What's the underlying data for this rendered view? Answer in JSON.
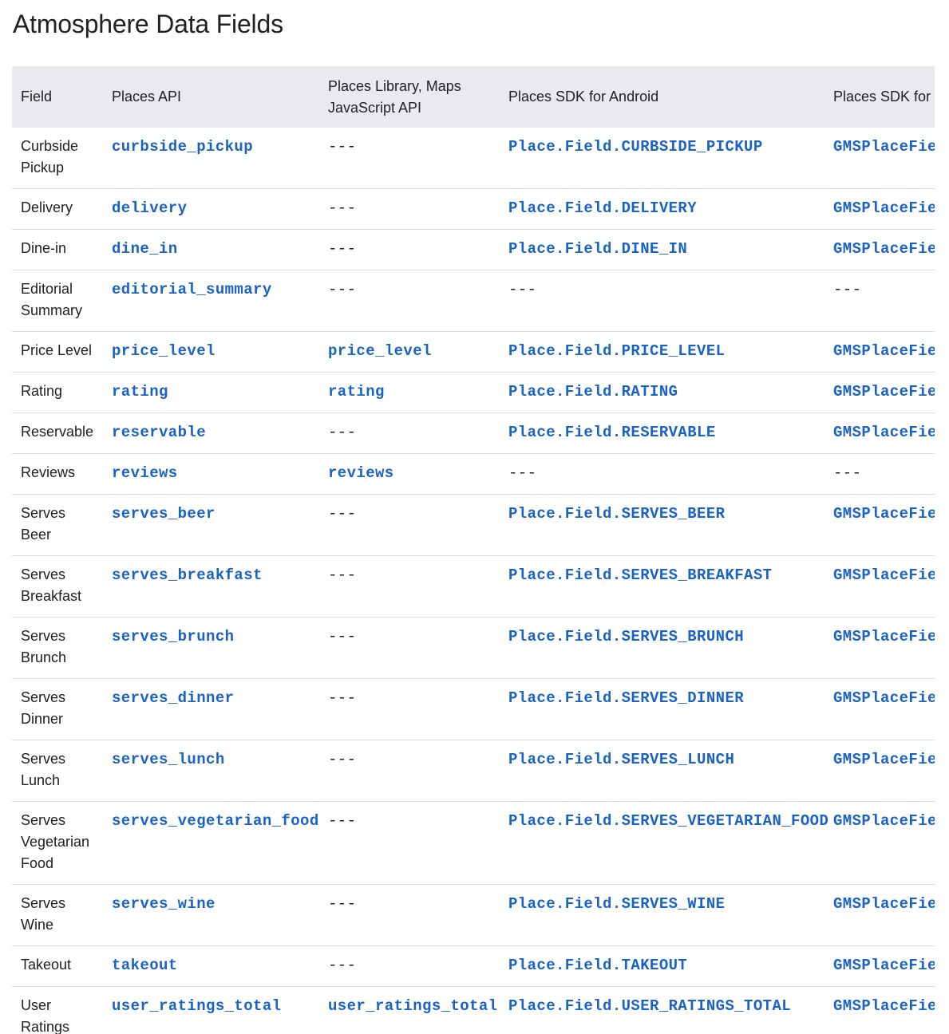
{
  "page": {
    "title": "Atmosphere Data Fields"
  },
  "table": {
    "headers": [
      "Field",
      "Places API",
      "Places Library, Maps JavaScript API",
      "Places SDK for Android",
      "Places SDK for"
    ],
    "rows": [
      {
        "field": "Curbside Pickup",
        "places_api": "curbside_pickup",
        "js_api": "---",
        "android": "Place.Field.CURBSIDE_PICKUP",
        "ios": "GMSPlaceFie"
      },
      {
        "field": "Delivery",
        "places_api": "delivery",
        "js_api": "---",
        "android": "Place.Field.DELIVERY",
        "ios": "GMSPlaceFie"
      },
      {
        "field": "Dine-in",
        "places_api": "dine_in",
        "js_api": "---",
        "android": "Place.Field.DINE_IN",
        "ios": "GMSPlaceFie"
      },
      {
        "field": "Editorial Summary",
        "places_api": "editorial_summary",
        "js_api": "---",
        "android": "---",
        "ios": "---"
      },
      {
        "field": "Price Level",
        "places_api": "price_level",
        "js_api": "price_level",
        "android": "Place.Field.PRICE_LEVEL",
        "ios": "GMSPlaceFie"
      },
      {
        "field": "Rating",
        "places_api": "rating",
        "js_api": "rating",
        "android": "Place.Field.RATING",
        "ios": "GMSPlaceFie"
      },
      {
        "field": "Reservable",
        "places_api": "reservable",
        "js_api": "---",
        "android": "Place.Field.RESERVABLE",
        "ios": "GMSPlaceFie"
      },
      {
        "field": "Reviews",
        "places_api": "reviews",
        "js_api": "reviews",
        "android": "---",
        "ios": "---"
      },
      {
        "field": "Serves Beer",
        "places_api": "serves_beer",
        "js_api": "---",
        "android": "Place.Field.SERVES_BEER",
        "ios": "GMSPlaceFie"
      },
      {
        "field": "Serves Breakfast",
        "places_api": "serves_breakfast",
        "js_api": "---",
        "android": "Place.Field.SERVES_BREAKFAST",
        "ios": "GMSPlaceFie"
      },
      {
        "field": "Serves Brunch",
        "places_api": "serves_brunch",
        "js_api": "---",
        "android": "Place.Field.SERVES_BRUNCH",
        "ios": "GMSPlaceFie"
      },
      {
        "field": "Serves Dinner",
        "places_api": "serves_dinner",
        "js_api": "---",
        "android": "Place.Field.SERVES_DINNER",
        "ios": "GMSPlaceFie"
      },
      {
        "field": "Serves Lunch",
        "places_api": "serves_lunch",
        "js_api": "---",
        "android": "Place.Field.SERVES_LUNCH",
        "ios": "GMSPlaceFie"
      },
      {
        "field": "Serves Vegetarian Food",
        "places_api": "serves_vegetarian_food",
        "js_api": "---",
        "android": "Place.Field.SERVES_VEGETARIAN_FOOD",
        "ios": "GMSPlaceFie"
      },
      {
        "field": "Serves Wine",
        "places_api": "serves_wine",
        "js_api": "---",
        "android": "Place.Field.SERVES_WINE",
        "ios": "GMSPlaceFie"
      },
      {
        "field": "Takeout",
        "places_api": "takeout",
        "js_api": "---",
        "android": "Place.Field.TAKEOUT",
        "ios": "GMSPlaceFie"
      },
      {
        "field": "User Ratings Total",
        "places_api": "user_ratings_total",
        "js_api": "user_ratings_total",
        "android": "Place.Field.USER_RATINGS_TOTAL",
        "ios": "GMSPlaceFie"
      }
    ]
  },
  "colors": {
    "link": "#1a62c4",
    "header_bg": "#e8eaed",
    "divider": "#dadce0",
    "text": "#202124"
  }
}
